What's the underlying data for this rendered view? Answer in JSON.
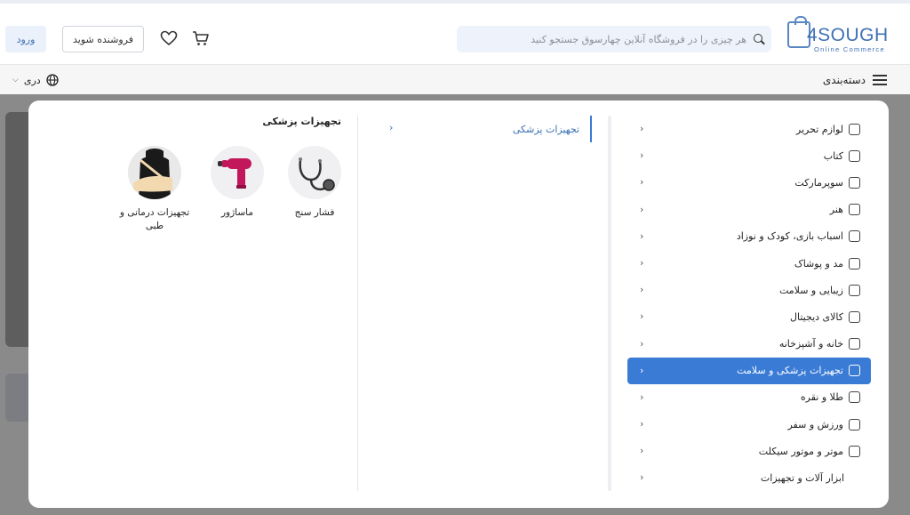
{
  "header": {
    "logo_brand": "4SOUGH",
    "logo_tagline": "Online Commerce",
    "search_placeholder": "هر چیزی را در فروشگاه آنلاین چهارسوق جستجو کنید",
    "seller_label": "فروشنده شوید",
    "login_label": "ورود"
  },
  "navbar": {
    "categories_label": "دسته‌بندی",
    "language_label": "دری"
  },
  "menu": {
    "categories": [
      {
        "label": "لوازم تحریر",
        "icon": "pen-icon"
      },
      {
        "label": "کتاب",
        "icon": "book-icon"
      },
      {
        "label": "سوپرمارکت",
        "icon": "store-icon"
      },
      {
        "label": "هنر",
        "icon": "palette-icon"
      },
      {
        "label": "اسباب بازی، کودک و نوزاد",
        "icon": "toy-icon"
      },
      {
        "label": "مد و پوشاک",
        "icon": "shirt-icon"
      },
      {
        "label": "زیبایی و سلامت",
        "icon": "beauty-icon"
      },
      {
        "label": "کالای دیجیتال",
        "icon": "laptop-icon"
      },
      {
        "label": "خانه و آشپزخانه",
        "icon": "kitchen-icon"
      },
      {
        "label": "تجهیزات پزشکی و سلامت",
        "icon": "medical-bag-icon",
        "active": true
      },
      {
        "label": "طلا و نقره",
        "icon": "gold-icon"
      },
      {
        "label": "ورزش و سفر",
        "icon": "sport-icon"
      },
      {
        "label": "موتر و موتور سیکلت",
        "icon": "car-icon"
      },
      {
        "label": "ابزار آلات و تجهیزات",
        "icon": ""
      }
    ],
    "subcategory": "تجهیزات پزشکی",
    "products_title": "تجهیزات پزشکی",
    "products": [
      {
        "label": "فشار سنج",
        "icon": "stethoscope-icon"
      },
      {
        "label": "ماساژور",
        "icon": "massage-gun-icon"
      },
      {
        "label": "تجهیزات درمانی و طبی",
        "icon": "arm-sling-icon"
      }
    ]
  },
  "colors": {
    "brand": "#3f70b5",
    "active_bg": "#3a7bd5",
    "overlay": "#8a8a8a"
  }
}
